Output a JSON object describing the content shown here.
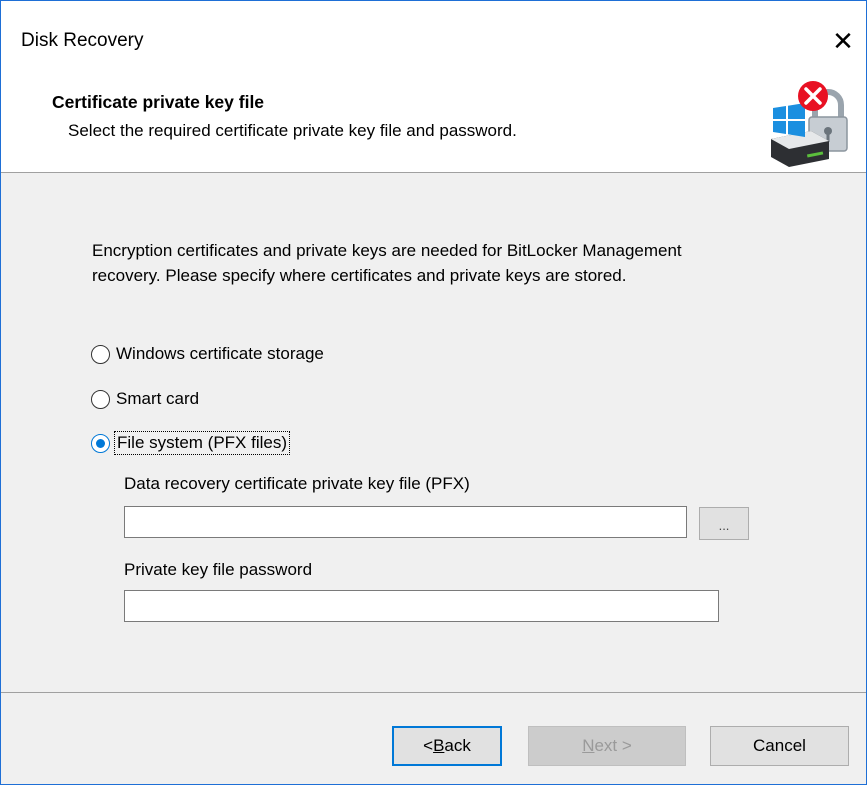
{
  "window": {
    "title": "Disk Recovery",
    "close_glyph": "✕"
  },
  "header": {
    "heading": "Certificate private key file",
    "subheading": "Select the required certificate private key file and password.",
    "icon": "encrypted-drive-error-icon"
  },
  "body": {
    "description": "Encryption certificates and private keys are needed for BitLocker Management recovery. Please specify where certificates and private keys are stored.",
    "options": [
      {
        "label": "Windows certificate storage",
        "selected": false
      },
      {
        "label": "Smart card",
        "selected": false
      },
      {
        "label": "File system (PFX files)",
        "selected": true
      }
    ],
    "pfx_label": "Data recovery certificate private key file (PFX)",
    "pfx_value": "",
    "browse_label": "...",
    "password_label": "Private key file password",
    "password_value": ""
  },
  "footer": {
    "back_prefix": "< ",
    "back_accel": "B",
    "back_rest": "ack",
    "next_accel": "N",
    "next_rest": "ext >",
    "cancel_label": "Cancel"
  },
  "colors": {
    "accent": "#0078d7",
    "window_border": "#1e6fd6",
    "error_red": "#e81123"
  }
}
